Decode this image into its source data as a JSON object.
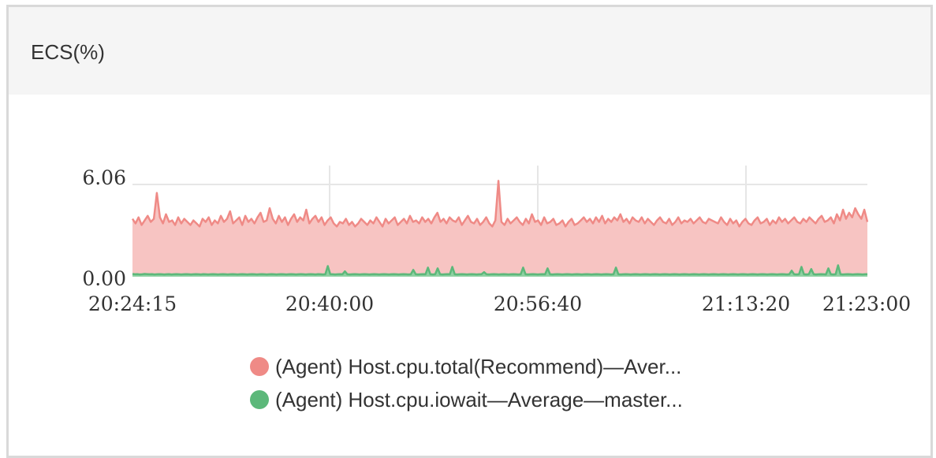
{
  "panel": {
    "title": "ECS(%)"
  },
  "chart_data": {
    "type": "area",
    "title": "ECS(%)",
    "xlabel": "",
    "ylabel": "",
    "ylim": [
      0,
      6.06
    ],
    "yticks": [
      "0.00",
      "6.06"
    ],
    "xticks": [
      "20:24:15",
      "20:40:00",
      "20:56:40",
      "21:13:20",
      "21:23:00"
    ],
    "xrange": [
      "20:24:15",
      "21:23:00"
    ],
    "grid": {
      "vertical": true,
      "horizontal": true
    },
    "legend_position": "bottom",
    "series": [
      {
        "name": "(Agent) Host.cpu.total(Recommend)—Aver...",
        "color": "#ef8a86",
        "fill": "#f7c4c2",
        "values": [
          3.8,
          3.5,
          3.9,
          3.4,
          3.7,
          4.0,
          3.6,
          3.8,
          5.5,
          3.9,
          3.5,
          4.1,
          3.6,
          3.7,
          3.4,
          3.9,
          3.5,
          3.8,
          3.6,
          3.4,
          3.7,
          3.5,
          3.3,
          3.8,
          3.6,
          3.9,
          3.4,
          3.7,
          3.5,
          4.0,
          3.6,
          3.8,
          4.3,
          3.5,
          3.7,
          3.9,
          3.4,
          4.0,
          3.6,
          3.8,
          3.5,
          3.9,
          4.2,
          3.6,
          3.7,
          4.5,
          3.8,
          3.5,
          4.0,
          3.6,
          3.9,
          3.4,
          3.8,
          4.1,
          3.6,
          3.9,
          3.7,
          4.4,
          3.5,
          3.8,
          4.0,
          3.6,
          3.9,
          3.4,
          3.7,
          3.9,
          3.5,
          3.3,
          3.6,
          3.5,
          3.8,
          3.4,
          3.6,
          3.3,
          3.5,
          3.8,
          3.6,
          3.4,
          3.7,
          3.5,
          3.9,
          3.6,
          3.3,
          3.8,
          3.5,
          3.7,
          3.9,
          3.4,
          3.6,
          3.8,
          3.5,
          4.0,
          3.6,
          3.7,
          3.5,
          3.9,
          3.6,
          3.8,
          3.5,
          3.9,
          4.2,
          3.6,
          3.8,
          3.5,
          3.9,
          3.7,
          3.6,
          3.9,
          3.4,
          3.7,
          4.0,
          3.6,
          3.5,
          3.8,
          3.4,
          3.6,
          3.9,
          3.5,
          3.3,
          3.7,
          6.3,
          3.6,
          3.4,
          3.8,
          3.5,
          3.7,
          3.9,
          3.6,
          3.4,
          3.8,
          3.5,
          4.1,
          3.6,
          3.7,
          3.4,
          3.9,
          3.5,
          3.6,
          3.8,
          3.4,
          3.5,
          3.7,
          3.3,
          3.6,
          3.8,
          3.4,
          3.5,
          3.7,
          3.9,
          3.6,
          3.8,
          3.5,
          3.9,
          3.6,
          4.0,
          3.5,
          3.8,
          3.6,
          3.9,
          3.7,
          4.1,
          3.6,
          3.8,
          3.5,
          3.9,
          3.7,
          3.6,
          3.9,
          3.5,
          3.8,
          3.6,
          3.4,
          3.7,
          3.9,
          3.6,
          3.5,
          3.8,
          3.4,
          3.6,
          3.9,
          3.5,
          3.7,
          3.6,
          3.8,
          3.5,
          3.7,
          3.9,
          3.6,
          3.5,
          3.8,
          3.7,
          3.6,
          3.5,
          3.9,
          3.6,
          3.4,
          3.8,
          3.5,
          3.7,
          3.3,
          3.6,
          3.8,
          3.5,
          3.4,
          3.7,
          3.9,
          3.5,
          3.6,
          3.8,
          3.4,
          3.7,
          3.5,
          3.9,
          3.6,
          3.8,
          3.5,
          3.7,
          3.9,
          3.6,
          3.5,
          3.8,
          3.6,
          3.9,
          3.7,
          3.5,
          3.8,
          4.0,
          3.6,
          3.7,
          3.9,
          3.5,
          4.1,
          3.7,
          4.4,
          3.8,
          4.2,
          3.9,
          4.5,
          4.1,
          3.8,
          4.4,
          3.6
        ]
      },
      {
        "name": "(Agent) Host.cpu.iowait—Average—master...",
        "color": "#5cb87a",
        "fill": "#8fd0a2",
        "values": [
          0.18,
          0.16,
          0.17,
          0.15,
          0.16,
          0.18,
          0.17,
          0.16,
          0.17,
          0.15,
          0.16,
          0.17,
          0.16,
          0.15,
          0.16,
          0.17,
          0.15,
          0.16,
          0.17,
          0.16,
          0.15,
          0.16,
          0.17,
          0.16,
          0.15,
          0.16,
          0.17,
          0.16,
          0.15,
          0.17,
          0.16,
          0.15,
          0.16,
          0.17,
          0.16,
          0.15,
          0.16,
          0.17,
          0.16,
          0.15,
          0.16,
          0.17,
          0.16,
          0.15,
          0.16,
          0.17,
          0.16,
          0.15,
          0.16,
          0.17,
          0.16,
          0.15,
          0.16,
          0.17,
          0.16,
          0.15,
          0.16,
          0.17,
          0.16,
          0.15,
          0.16,
          0.17,
          0.16,
          0.15,
          0.16,
          0.17,
          0.16,
          0.15,
          0.16,
          0.17,
          0.16,
          0.15,
          0.16,
          0.17,
          0.16,
          0.15,
          0.17,
          0.16,
          0.15,
          0.16,
          0.7,
          0.17,
          0.16,
          0.15,
          0.16,
          0.17,
          0.16,
          0.35,
          0.16,
          0.15,
          0.16,
          0.17,
          0.16,
          0.15,
          0.16,
          0.17,
          0.16,
          0.15,
          0.16,
          0.17,
          0.16,
          0.15,
          0.16,
          0.17,
          0.16,
          0.15,
          0.16,
          0.17,
          0.16,
          0.15,
          0.16,
          0.17,
          0.16,
          0.15,
          0.16,
          0.45,
          0.16,
          0.15,
          0.16,
          0.17,
          0.16,
          0.6,
          0.16,
          0.15,
          0.16,
          0.55,
          0.16,
          0.15,
          0.16,
          0.17,
          0.16,
          0.65,
          0.16,
          0.15,
          0.16,
          0.17,
          0.16,
          0.15,
          0.16,
          0.17,
          0.16,
          0.15,
          0.16,
          0.17,
          0.3,
          0.16,
          0.15,
          0.16,
          0.17,
          0.16,
          0.15,
          0.16,
          0.17,
          0.16,
          0.15,
          0.16,
          0.17,
          0.16,
          0.15,
          0.16,
          0.6,
          0.16,
          0.15,
          0.16,
          0.17,
          0.16,
          0.15,
          0.16,
          0.17,
          0.16,
          0.55,
          0.16,
          0.15,
          0.16,
          0.17,
          0.16,
          0.15,
          0.16,
          0.17,
          0.16,
          0.15,
          0.16,
          0.17,
          0.16,
          0.15,
          0.16,
          0.17,
          0.16,
          0.15,
          0.16,
          0.17,
          0.16,
          0.15,
          0.16,
          0.17,
          0.16,
          0.15,
          0.16,
          0.6,
          0.16,
          0.15,
          0.16,
          0.17,
          0.16,
          0.15,
          0.16,
          0.17,
          0.16,
          0.15,
          0.16,
          0.17,
          0.16,
          0.15,
          0.16,
          0.17,
          0.16,
          0.15,
          0.16,
          0.17,
          0.16,
          0.15,
          0.16,
          0.17,
          0.16,
          0.15,
          0.16,
          0.17,
          0.16,
          0.15,
          0.16,
          0.17,
          0.16,
          0.15,
          0.16,
          0.17,
          0.16,
          0.15,
          0.16,
          0.17,
          0.16,
          0.15,
          0.16,
          0.17,
          0.16,
          0.15,
          0.16,
          0.17,
          0.16,
          0.15,
          0.16,
          0.17,
          0.16,
          0.15,
          0.16,
          0.17,
          0.16,
          0.15,
          0.16,
          0.17,
          0.16,
          0.15,
          0.16,
          0.17,
          0.16,
          0.15,
          0.16,
          0.17,
          0.16,
          0.15,
          0.16,
          0.4,
          0.16,
          0.15,
          0.16,
          0.65,
          0.16,
          0.15,
          0.16,
          0.5,
          0.16,
          0.15,
          0.16,
          0.17,
          0.16,
          0.15,
          0.55,
          0.16,
          0.15,
          0.16,
          0.75,
          0.16,
          0.15,
          0.16,
          0.17,
          0.16,
          0.15,
          0.16,
          0.17,
          0.16,
          0.15,
          0.16,
          0.17
        ]
      }
    ]
  }
}
